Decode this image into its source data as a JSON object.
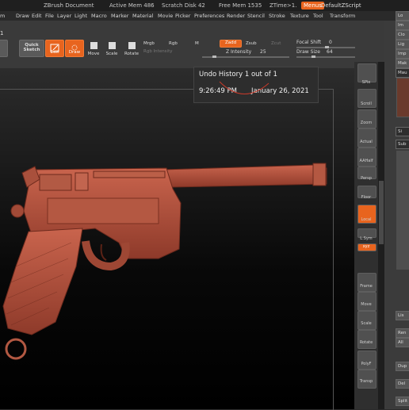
{
  "titlebar": {
    "doc": "ZBrush Document",
    "active_mem": "Active Mem 486",
    "scratch_disk": "Scratch Disk 42",
    "free_mem": "Free Mem 1535",
    "ztime": "ZTime>1.",
    "menus": "Menus",
    "zscript": "DefaultZScript"
  },
  "menubar": [
    "Draw",
    "Edit",
    "File",
    "Layer",
    "Light",
    "Macro",
    "Marker",
    "Material",
    "Movie",
    "Picker",
    "Preferences",
    "Render",
    "Stencil",
    "Stroke",
    "Texture",
    "Tool",
    "Transform"
  ],
  "shelf": {
    "left_number": "1",
    "quick_sketch": "Quick Sketch",
    "edit": "Edit",
    "draw": "Draw",
    "move": "Move",
    "scale": "Scale",
    "rotate": "Rotate",
    "mrgb": "Mrgb",
    "rgb": "Rgb",
    "m": "M",
    "rgb_intensity": "Rgb Intensity",
    "zadd": "Zadd",
    "zsub": "Zsub",
    "zcut": "Zcut",
    "z_intensity_label": "Z Intensity",
    "z_intensity_value": "25",
    "focal_shift_label": "Focal Shift",
    "focal_shift_value": "0",
    "draw_size_label": "Draw Size",
    "draw_size_value": "64"
  },
  "undo_popup": {
    "title": "Undo History 1 out of 1",
    "time": "9:26:49 PM",
    "date": "January 26, 2021"
  },
  "right_shelf": [
    {
      "label": "SPix",
      "icon": "spix-icon"
    },
    {
      "label": "Scroll",
      "icon": "scroll-icon"
    },
    {
      "label": "Zoom",
      "icon": "zoom-icon"
    },
    {
      "label": "Actual",
      "icon": "actual-icon"
    },
    {
      "label": "AAHalf",
      "icon": "aahalf-icon"
    },
    {
      "label": "Persp",
      "icon": "persp-icon"
    },
    {
      "label": "Floor",
      "icon": "floor-icon"
    },
    {
      "label": "Local",
      "icon": "local-icon"
    },
    {
      "label": "L.Sym",
      "icon": "lsym-icon"
    },
    {
      "label": "xyz",
      "icon": "xyz-icon"
    },
    {
      "label": "Frame",
      "icon": "frame-icon"
    },
    {
      "label": "Move",
      "icon": "move-icon"
    },
    {
      "label": "Scale",
      "icon": "scale-icon"
    },
    {
      "label": "Rotate",
      "icon": "rotate-icon"
    },
    {
      "label": "PolyF",
      "icon": "polyf-icon"
    },
    {
      "label": "Transp",
      "icon": "transp-icon"
    }
  ],
  "tray": [
    "Lo",
    "Im",
    "Clo",
    "Lig",
    "Imp",
    "Mak",
    "",
    "",
    "Mau",
    "",
    "",
    "Si",
    "Sub",
    "",
    "",
    "",
    "",
    "",
    "",
    "Lis",
    "Ren",
    "All",
    "",
    "Dup",
    "Del",
    "Split"
  ],
  "colors": {
    "accent": "#e8641e",
    "model": "#b8523e"
  }
}
